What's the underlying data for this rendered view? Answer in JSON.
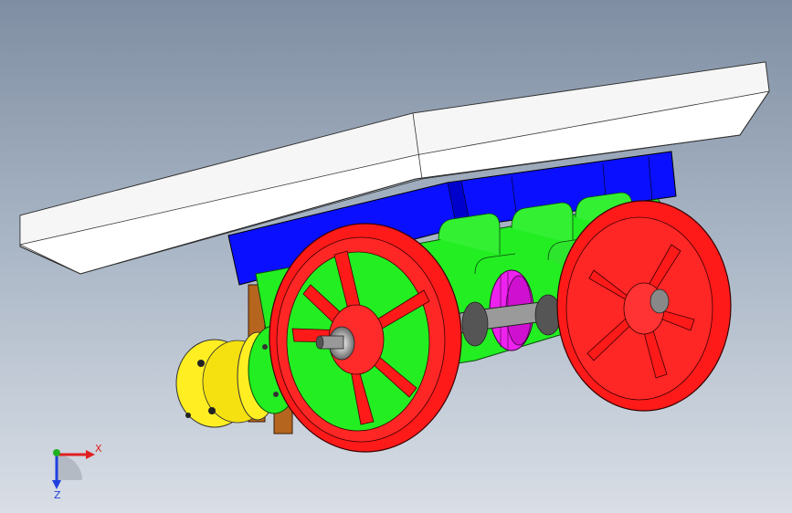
{
  "colors": {
    "background_top": "#7f8ea2",
    "background_bottom": "#d9dee6",
    "top_plate": "#ffffff",
    "frame": "#0000ff",
    "chassis": "#22ee22",
    "wheel": "#ff0000",
    "pulley": "#ffee22",
    "gear": "#ee22ee",
    "axle": "#888888",
    "bracket": "#b5651d",
    "axis_x": "#e02020",
    "axis_y": "#20b020",
    "axis_z": "#2040e0"
  },
  "icons": {
    "triad": "coordinate-triad-icon"
  },
  "triad": {
    "x_label": "X",
    "z_label": "Z"
  }
}
